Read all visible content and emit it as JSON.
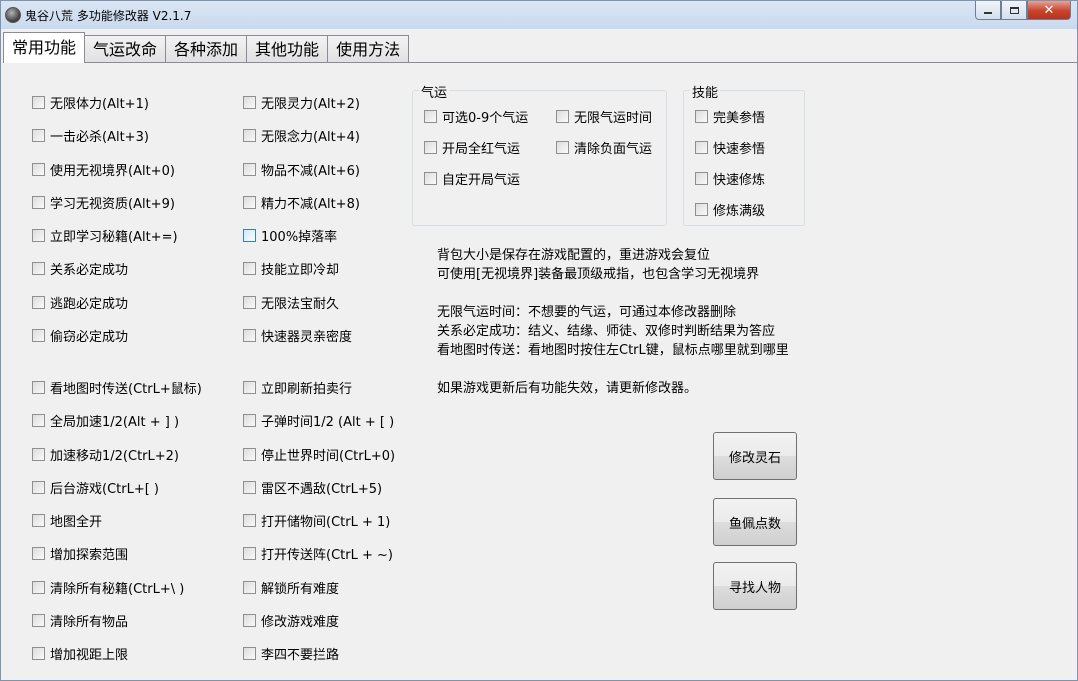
{
  "window": {
    "title": "鬼谷八荒 多功能修改器  V2.1.7",
    "close_glyph": "✕"
  },
  "tabs": [
    {
      "label": "常用功能",
      "active": true
    },
    {
      "label": "气运改命",
      "active": false
    },
    {
      "label": "各种添加",
      "active": false
    },
    {
      "label": "其他功能",
      "active": false
    },
    {
      "label": "使用方法",
      "active": false
    }
  ],
  "col1": [
    "无限体力(Alt+1)",
    "一击必杀(Alt+3)",
    "使用无视境界(Alt+0)",
    "学习无视资质(Alt+9)",
    "立即学习秘籍(Alt+=)",
    "关系必定成功",
    "逃跑必定成功",
    "偷窃必定成功",
    "看地图时传送(CtrL+鼠标)",
    "全局加速1/2(Alt + ] )",
    "加速移动1/2(CtrL+2)",
    "后台游戏(CtrL+[ )",
    "地图全开",
    "增加探索范围",
    "清除所有秘籍(CtrL+\\ )",
    "清除所有物品",
    "增加视距上限"
  ],
  "col2": [
    "无限灵力(Alt+2)",
    "无限念力(Alt+4)",
    "物品不减(Alt+6)",
    "精力不减(Alt+8)",
    "100%掉落率",
    "技能立即冷却",
    "无限法宝耐久",
    "快速器灵亲密度",
    "立即刷新拍卖行",
    "子弹时间1/2 (Alt + [ )",
    "停止世界时间(CtrL+0)",
    "雷区不遇敌(CtrL+5)",
    "打开储物间(CtrL + 1)",
    "打开传送阵(CtrL + ~)",
    "解锁所有难度",
    "修改游戏难度",
    "李四不要拦路"
  ],
  "qiyun": {
    "title": "气运",
    "items": [
      "可选0-9个气运",
      "无限气运时间",
      "开局全红气运",
      "清除负面气运",
      "自定开局气运"
    ]
  },
  "jineng": {
    "title": "技能",
    "items": [
      "完美参悟",
      "快速参悟",
      "快速修炼",
      "修炼满级"
    ]
  },
  "notes": [
    "背包大小是保存在游戏配置的，重进游戏会复位",
    "可使用[无视境界]装备最顶级戒指，也包含学习无视境界",
    "无限气运时间：不想要的气运，可通过本修改器删除",
    "关系必定成功：结义、结缘、师徒、双修时判断结果为答应",
    "看地图时传送：看地图时按住左CtrL键，鼠标点哪里就到哪里",
    "如果游戏更新后有功能失效，请更新修改器。"
  ],
  "buttons": {
    "lingshi": "修改灵石",
    "yupei": "鱼佩点数",
    "renwu": "寻找人物"
  }
}
